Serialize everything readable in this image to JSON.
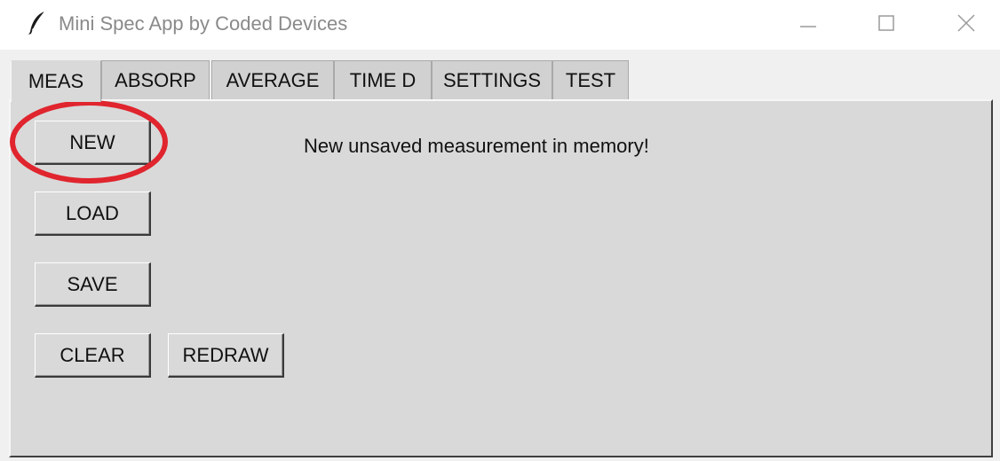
{
  "window": {
    "title": "Mini Spec App by Coded Devices",
    "icon": "feather-icon"
  },
  "tabs": [
    {
      "label": "MEAS",
      "active": true
    },
    {
      "label": "ABSORP",
      "active": false
    },
    {
      "label": "AVERAGE",
      "active": false
    },
    {
      "label": "TIME D",
      "active": false
    },
    {
      "label": "SETTINGS",
      "active": false
    },
    {
      "label": "TEST",
      "active": false
    }
  ],
  "meas_panel": {
    "buttons": {
      "new": "NEW",
      "load": "LOAD",
      "save": "SAVE",
      "clear": "CLEAR",
      "redraw": "REDRAW"
    },
    "status": "New unsaved measurement in memory!"
  },
  "annotation": {
    "color": "#e0252e",
    "target": "new-button"
  }
}
